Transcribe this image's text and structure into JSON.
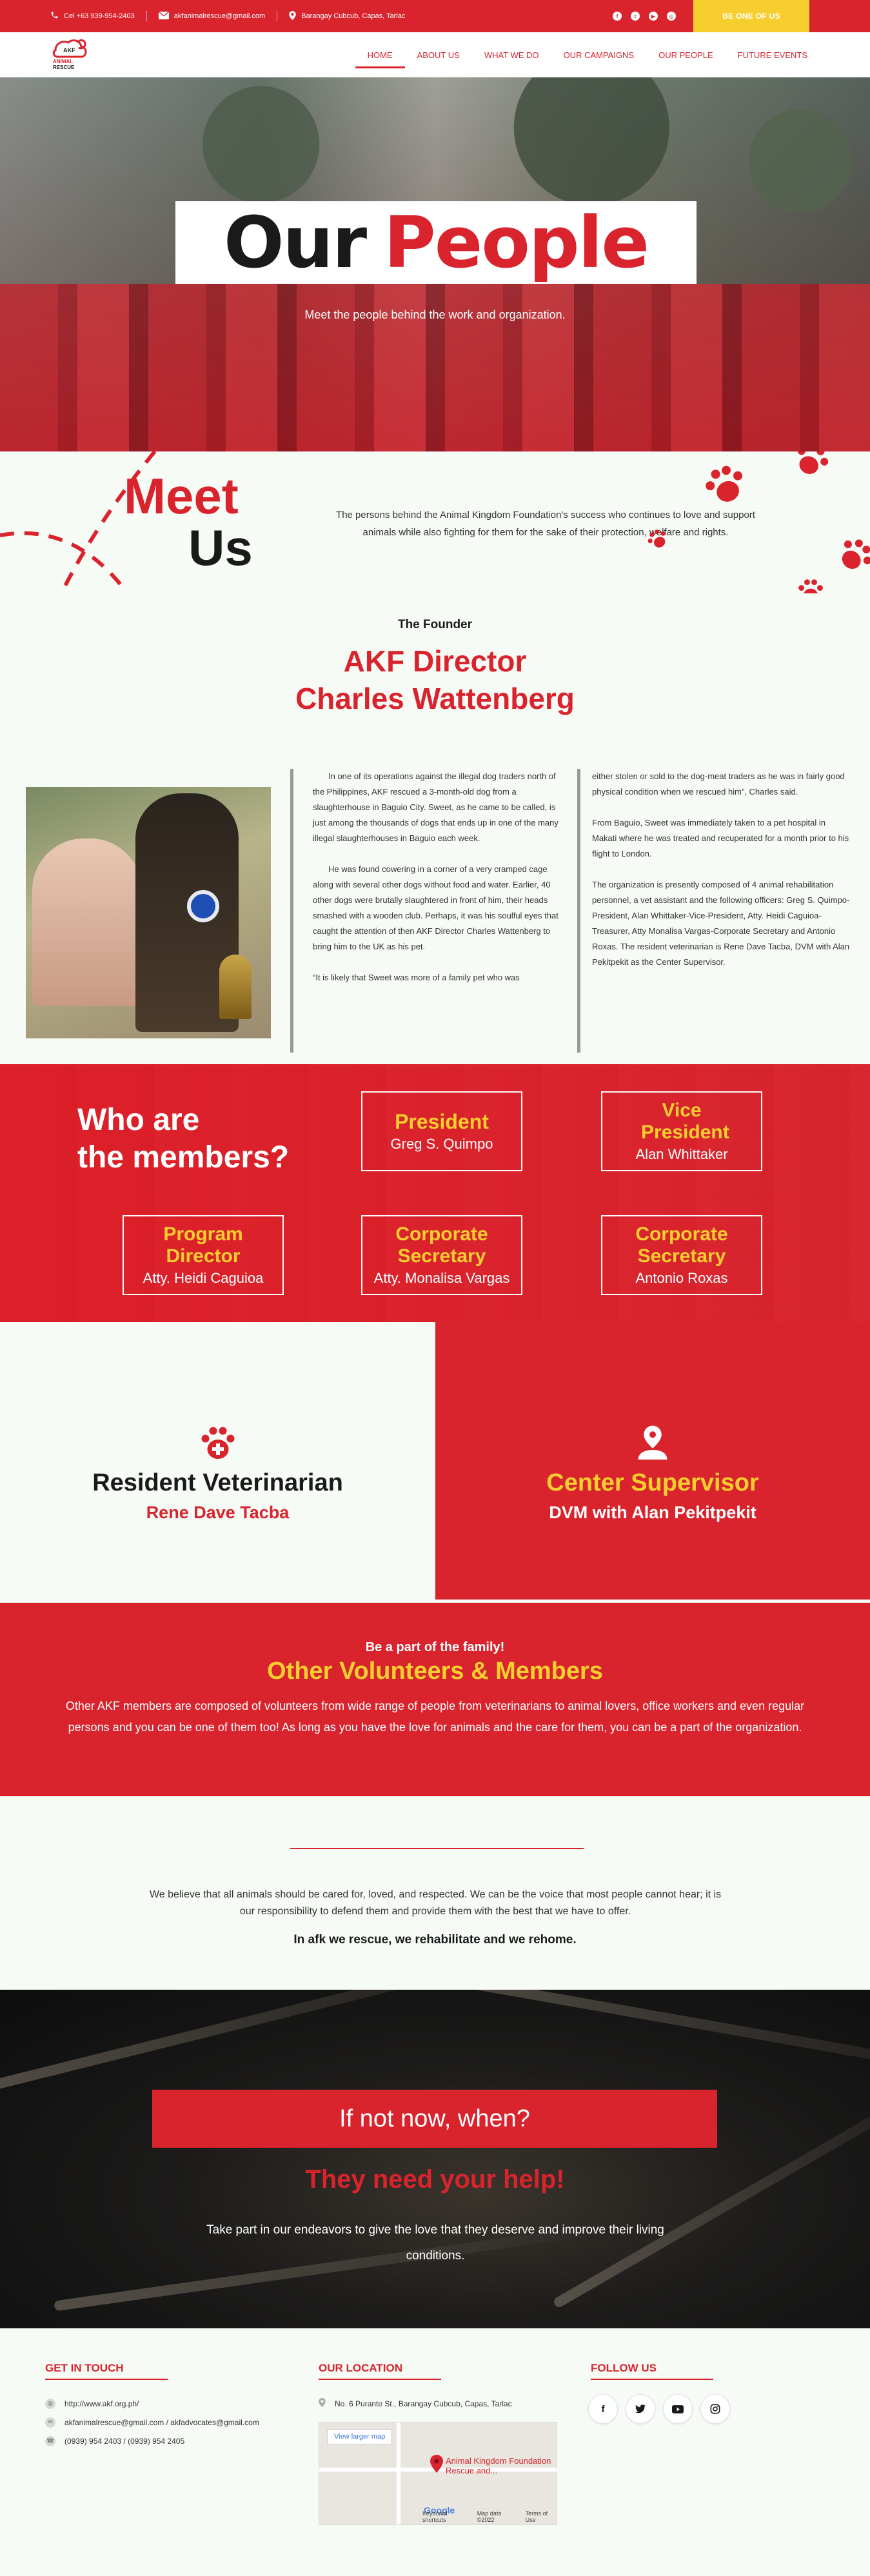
{
  "topbar": {
    "phone": "Cel +63 939-954-2403",
    "email": "akfanimalrescue@gmail.com",
    "location": "Barangay Cubcub, Capas, Tarlac",
    "social_icons": [
      "facebook-icon",
      "twitter-icon",
      "youtube-icon",
      "instagram-icon"
    ],
    "cta": "BE ONE OF US"
  },
  "nav": {
    "logo_text": "AKF ANIMAL RESCUE",
    "items": [
      "HOME",
      "ABOUT US",
      "WHAT WE DO",
      "OUR CAMPAIGNS",
      "OUR PEOPLE",
      "FUTURE EVENTS"
    ],
    "active": "HOME"
  },
  "hero": {
    "title_dark": "Our",
    "title_red": "People",
    "subtitle": "Meet the people behind the work and organization."
  },
  "meet": {
    "word1": "Meet",
    "word2": "Us",
    "text": "The persons behind the Animal Kingdom Foundation's success who continues to love and support animals while also fighting for them for the sake of their protection, welfare and rights."
  },
  "founder": {
    "label": "The Founder",
    "title_line1": "AKF Director",
    "title_line2": "Charles Wattenberg"
  },
  "story": {
    "col1": [
      "In one of its operations against the illegal dog traders north of the Philippines, AKF rescued a 3-month-old dog from a slaughterhouse in Baguio City. Sweet, as he came to be called, is just among the thousands of dogs that ends up in one of the many illegal slaughterhouses in Baguio each week.",
      "He was found cowering in a corner of a very cramped cage along with several other dogs without food and water. Earlier, 40 other dogs were brutally slaughtered in front of him, their heads smashed with a wooden club. Perhaps, it was his soulful eyes that caught the attention of then AKF Director Charles Wattenberg to bring him to the UK as his pet.",
      "“It is likely that Sweet was more of a family pet who was"
    ],
    "col2": [
      "either stolen or sold to the dog-meat traders as he was in fairly good physical condition when we rescued him”, Charles said.",
      "From Baguio, Sweet was immediately taken to a pet hospital in Makati where he was treated and recuperated for a month prior to his flight to London.",
      "The organization is presently composed of 4 animal rehabilitation personnel, a vet assistant and the following officers: Greg S. Quimpo-President, Alan Whittaker-Vice-President, Atty. Heidi Caguioa-Treasurer, Atty Monalisa Vargas-Corporate Secretary and Antonio Roxas. The resident veterinarian is Rene Dave Tacba, DVM with Alan Pekitpekit as the Center Supervisor."
    ]
  },
  "members": {
    "heading_line1": "Who are",
    "heading_line2": "the members?",
    "boxes": [
      {
        "role": "President",
        "name": "Greg S. Quimpo"
      },
      {
        "role": "Vice President",
        "name": "Alan Whittaker"
      },
      {
        "role": "Program Director",
        "name": "Atty. Heidi Caguioa"
      },
      {
        "role": "Corporate Secretary",
        "name": "Atty. Monalisa Vargas"
      },
      {
        "role": "Corporate Secretary",
        "name": "Antonio Roxas"
      }
    ]
  },
  "staff": {
    "vet_title": "Resident Veterinarian",
    "vet_name": "Rene Dave Tacba",
    "sup_title": "Center Supervisor",
    "sup_name": "DVM with Alan Pekitpekit"
  },
  "volunteers": {
    "kicker": "Be a part of the family!",
    "heading": "Other Volunteers & Members",
    "text": "Other AKF members are composed of volunteers from wide range of people from veterinarians to animal lovers, office workers and even regular persons and you can be one of them too! As long as you have the love for animals and the care for them, you can be a part of the organization."
  },
  "believe": {
    "text": "We believe that all animals should be cared for, loved, and respected. We can be the voice that most people cannot hear; it is our responsibility to defend them and provide them with the best that we have to offer.",
    "bold": "In afk we rescue, we rehabilitate and we rehome."
  },
  "cta": {
    "banner": "If not now, when?",
    "help": "They need your help!",
    "text": "Take part in our endeavors to give the love that they deserve and improve their living conditions."
  },
  "footer": {
    "contact_heading": "GET IN TOUCH",
    "website": "http://www.akf.org.ph/",
    "emails": "akfanimalrescue@gmail.com / akfadvocates@gmail.com",
    "phones": "(0939) 954 2403 / (0939) 954 2405",
    "location_heading": "OUR LOCATION",
    "address": "No. 6 Purante St., Barangay Cubcub, Capas, Tarlac",
    "map_link": "View larger map",
    "map_pin_label": "Animal Kingdom Foundation Rescue and...",
    "map_brand": "Google",
    "map_footer": [
      "Keyboard shortcuts",
      "Map data ©2022",
      "Terms of Use"
    ],
    "follow_heading": "FOLLOW US",
    "follow_icons": [
      "facebook-icon",
      "twitter-icon",
      "youtube-icon",
      "instagram-icon"
    ]
  },
  "colors": {
    "brand_red": "#d9232d",
    "accent_yellow": "#f6cf2f",
    "background": "#f6fbf6"
  }
}
